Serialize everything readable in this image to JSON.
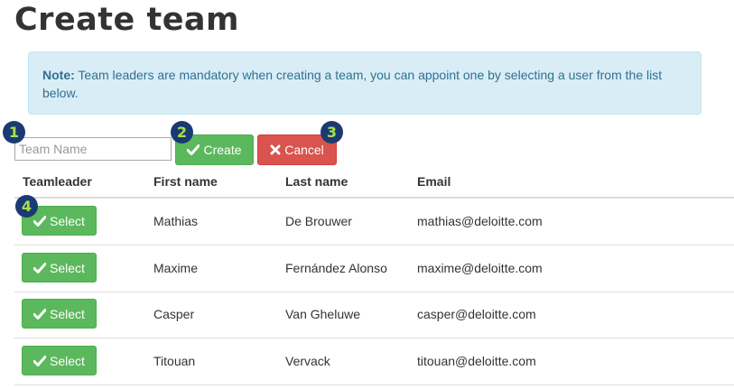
{
  "page": {
    "title": "Create team"
  },
  "note": {
    "label": "Note:",
    "text": " Team leaders are mandatory when creating a team, you can appoint one by selecting a user from the list below."
  },
  "form": {
    "team_name_placeholder": "Team Name",
    "create_label": "Create",
    "cancel_label": "Cancel"
  },
  "markers": [
    "1",
    "2",
    "3",
    "4"
  ],
  "table": {
    "headers": [
      "Teamleader",
      "First name",
      "Last name",
      "Email"
    ],
    "select_label": "Select",
    "rows": [
      {
        "first": "Mathias",
        "last": "De Brouwer",
        "email": "mathias@deloitte.com"
      },
      {
        "first": "Maxime",
        "last": "Fernández Alonso",
        "email": "maxime@deloitte.com"
      },
      {
        "first": "Casper",
        "last": "Van Gheluwe",
        "email": "casper@deloitte.com"
      },
      {
        "first": "Titouan",
        "last": "Vervack",
        "email": "titouan@deloitte.com"
      }
    ]
  },
  "colors": {
    "success": "#5cb85c",
    "danger": "#d9534f",
    "info_bg": "#d9edf7",
    "info_text": "#31708f",
    "marker_bg": "#1a3a73",
    "marker_text": "#a8e04a"
  },
  "icons": {
    "check": "check-icon",
    "cross": "cross-icon"
  }
}
